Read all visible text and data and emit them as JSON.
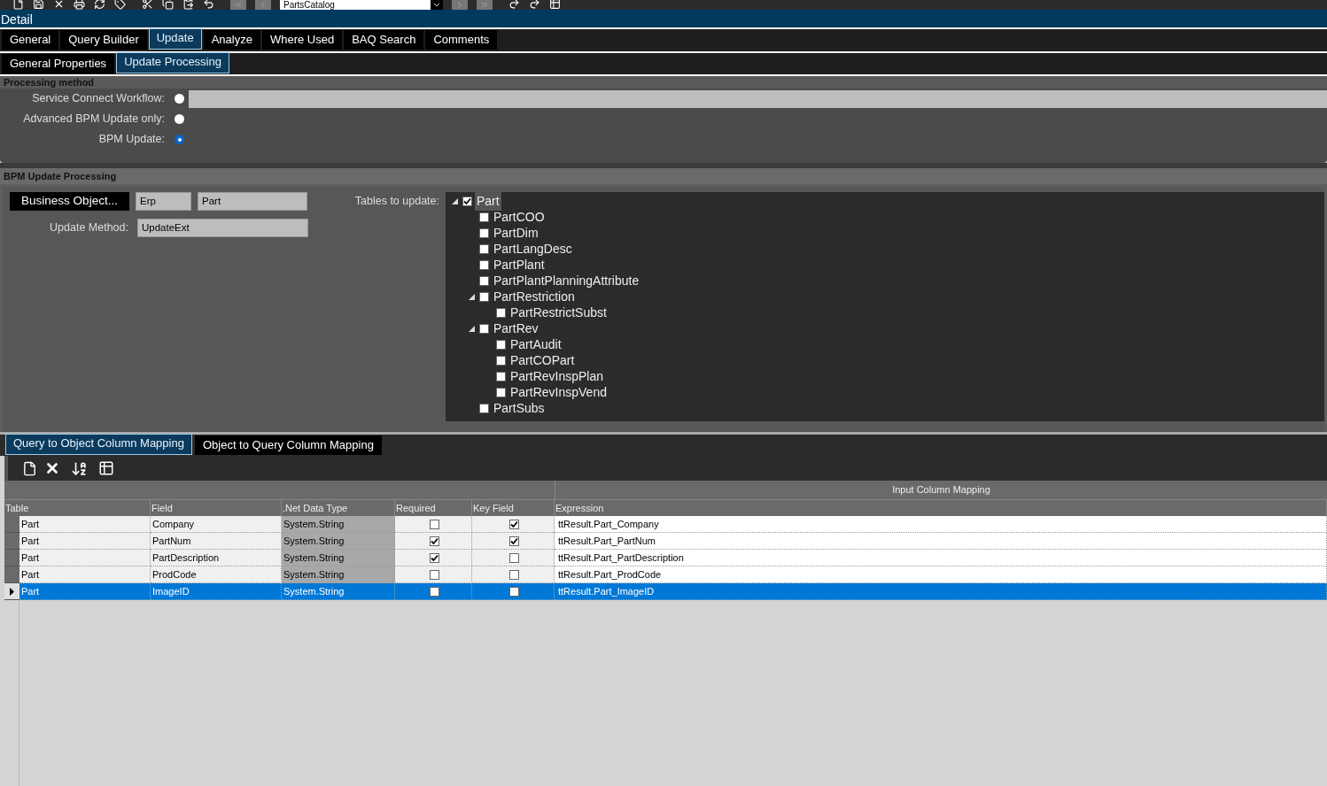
{
  "toolbar": {
    "combo_value": "PartsCatalog"
  },
  "panel_title": "Detail",
  "tabs": [
    {
      "label": "General",
      "selected": false
    },
    {
      "label": "Query Builder",
      "selected": false
    },
    {
      "label": "Update",
      "selected": true
    },
    {
      "label": "Analyze",
      "selected": false
    },
    {
      "label": "Where Used",
      "selected": false
    },
    {
      "label": "BAQ Search",
      "selected": false
    },
    {
      "label": "Comments",
      "selected": false
    }
  ],
  "sub_tabs": [
    {
      "label": "General Properties",
      "selected": false
    },
    {
      "label": "Update  Processing",
      "selected": true
    }
  ],
  "processing_method": {
    "title": "Processing method",
    "options": [
      {
        "label": "Service Connect Workflow:",
        "selected": false,
        "has_field": true
      },
      {
        "label": "Advanced BPM Update only:",
        "selected": false,
        "has_field": false
      },
      {
        "label": "BPM Update:",
        "selected": true,
        "has_field": false
      }
    ]
  },
  "bpm_update": {
    "title": "BPM Update Processing",
    "business_object_button": "Business Object...",
    "bo_fields": [
      "Erp",
      "Part"
    ],
    "update_method_label": "Update Method:",
    "update_method": "UpdateExt",
    "tables_label": "Tables to update:",
    "tree": [
      {
        "label": "Part",
        "checked": true,
        "selected": true,
        "expanded": true,
        "children": [
          {
            "label": "PartCOO",
            "checked": false,
            "selected": false
          },
          {
            "label": "PartDim",
            "checked": false,
            "selected": false
          },
          {
            "label": "PartLangDesc",
            "checked": false,
            "selected": false
          },
          {
            "label": "PartPlant",
            "checked": false,
            "selected": false
          },
          {
            "label": "PartPlantPlanningAttribute",
            "checked": false,
            "selected": false
          },
          {
            "label": "PartRestriction",
            "checked": false,
            "selected": false,
            "expanded": true,
            "children": [
              {
                "label": "PartRestrictSubst",
                "checked": false,
                "selected": false
              }
            ]
          },
          {
            "label": "PartRev",
            "checked": false,
            "selected": false,
            "expanded": true,
            "children": [
              {
                "label": "PartAudit",
                "checked": false,
                "selected": false
              },
              {
                "label": "PartCOPart",
                "checked": false,
                "selected": false
              },
              {
                "label": "PartRevInspPlan",
                "checked": false,
                "selected": false
              },
              {
                "label": "PartRevInspVend",
                "checked": false,
                "selected": false
              }
            ]
          },
          {
            "label": "PartSubs",
            "checked": false,
            "selected": false
          }
        ]
      }
    ]
  },
  "mapping_tabs": [
    {
      "label": "Query to Object Column Mapping",
      "selected": true
    },
    {
      "label": "Object to Query Column Mapping",
      "selected": false
    }
  ],
  "grid": {
    "group_header": "Input Column Mapping",
    "columns": [
      "Table",
      "Field",
      ".Net Data Type",
      "Required",
      "Key Field",
      "Expression"
    ],
    "rows": [
      {
        "table": "Part",
        "field": "Company",
        "type": "System.String",
        "required": false,
        "key_field": true,
        "expression": "ttResult.Part_Company",
        "selected": false
      },
      {
        "table": "Part",
        "field": "PartNum",
        "type": "System.String",
        "required": true,
        "key_field": true,
        "expression": "ttResult.Part_PartNum",
        "selected": false
      },
      {
        "table": "Part",
        "field": "PartDescription",
        "type": "System.String",
        "required": true,
        "key_field": false,
        "expression": "ttResult.Part_PartDescription",
        "selected": false
      },
      {
        "table": "Part",
        "field": "ProdCode",
        "type": "System.String",
        "required": false,
        "key_field": false,
        "expression": "ttResult.Part_ProdCode",
        "selected": false
      },
      {
        "table": "Part",
        "field": "ImageID",
        "type": "System.String",
        "required": false,
        "key_field": false,
        "expression": "ttResult.Part_ImageID",
        "selected": true
      }
    ]
  }
}
